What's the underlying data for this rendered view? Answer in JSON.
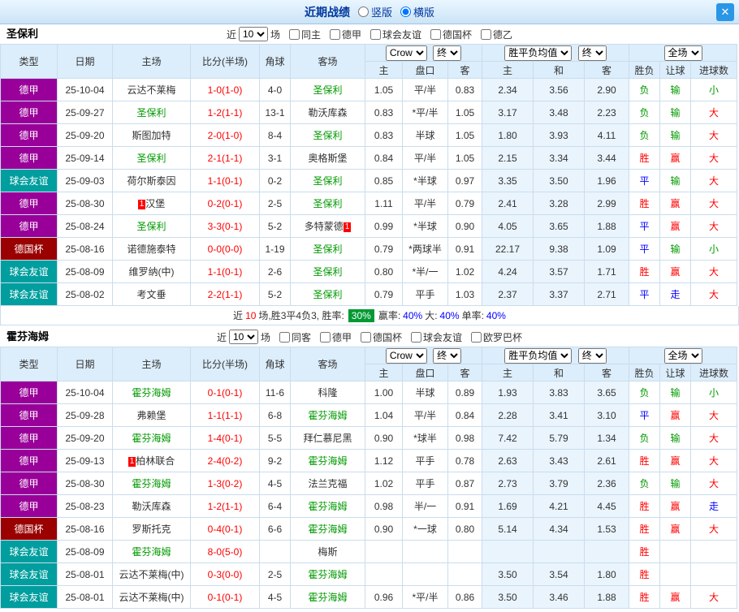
{
  "titlebar": {
    "title": "近期战绩",
    "vertical": "竖版",
    "horizontal": "横版",
    "close_icon": "✕"
  },
  "columns": {
    "type": "类型",
    "date": "日期",
    "home": "主场",
    "score": "比分(半场)",
    "corner": "角球",
    "away": "客场",
    "o_home": "主",
    "o_line": "盘口",
    "o_away": "客",
    "a_home": "主",
    "a_draw": "和",
    "a_away": "客",
    "r_wdl": "胜负",
    "r_handicap": "让球",
    "r_goals": "进球数"
  },
  "dropdowns": {
    "crow": "Crow",
    "final": "终",
    "avg": "胜平负均值",
    "full": "全场"
  },
  "badge_text": "1",
  "sections": [
    {
      "team": "圣保利",
      "filter": {
        "near": "近",
        "count": "10",
        "unit": "场",
        "checks": [
          "同主",
          "德甲",
          "球会友谊",
          "德国杯",
          "德乙"
        ]
      },
      "rows": [
        {
          "type": "德甲",
          "tc": "purple",
          "date": "25-10-04",
          "home": {
            "name": "云达不莱梅"
          },
          "score": "1-0(1-0)",
          "corner": "4-0",
          "away": {
            "name": "圣保利",
            "tracked": true
          },
          "odds": [
            "1.05",
            "平/半",
            "0.83"
          ],
          "avg": [
            "2.34",
            "3.56",
            "2.90"
          ],
          "res": [
            [
              "负",
              "g"
            ],
            [
              "输",
              "g"
            ],
            [
              "小",
              "g"
            ]
          ]
        },
        {
          "type": "德甲",
          "tc": "purple",
          "date": "25-09-27",
          "home": {
            "name": "圣保利",
            "tracked": true
          },
          "score": "1-2(1-1)",
          "corner": "13-1",
          "away": {
            "name": "勒沃库森"
          },
          "odds": [
            "0.83",
            "*平/半",
            "1.05"
          ],
          "avg": [
            "3.17",
            "3.48",
            "2.23"
          ],
          "res": [
            [
              "负",
              "g"
            ],
            [
              "输",
              "g"
            ],
            [
              "大",
              "r"
            ]
          ]
        },
        {
          "type": "德甲",
          "tc": "purple",
          "date": "25-09-20",
          "home": {
            "name": "斯图加特"
          },
          "score": "2-0(1-0)",
          "corner": "8-4",
          "away": {
            "name": "圣保利",
            "tracked": true
          },
          "odds": [
            "0.83",
            "半球",
            "1.05"
          ],
          "avg": [
            "1.80",
            "3.93",
            "4.11"
          ],
          "res": [
            [
              "负",
              "g"
            ],
            [
              "输",
              "g"
            ],
            [
              "大",
              "r"
            ]
          ]
        },
        {
          "type": "德甲",
          "tc": "purple",
          "date": "25-09-14",
          "home": {
            "name": "圣保利",
            "tracked": true
          },
          "score": "2-1(1-1)",
          "corner": "3-1",
          "away": {
            "name": "奥格斯堡"
          },
          "odds": [
            "0.84",
            "平/半",
            "1.05"
          ],
          "avg": [
            "2.15",
            "3.34",
            "3.44"
          ],
          "res": [
            [
              "胜",
              "r"
            ],
            [
              "赢",
              "r"
            ],
            [
              "大",
              "r"
            ]
          ]
        },
        {
          "type": "球会友谊",
          "tc": "teal",
          "date": "25-09-03",
          "home": {
            "name": "荷尔斯泰因"
          },
          "score": "1-1(0-1)",
          "corner": "0-2",
          "away": {
            "name": "圣保利",
            "tracked": true
          },
          "odds": [
            "0.85",
            "*半球",
            "0.97"
          ],
          "avg": [
            "3.35",
            "3.50",
            "1.96"
          ],
          "res": [
            [
              "平",
              "b"
            ],
            [
              "输",
              "g"
            ],
            [
              "大",
              "r"
            ]
          ]
        },
        {
          "type": "德甲",
          "tc": "purple",
          "date": "25-08-30",
          "home": {
            "name": "汉堡",
            "badge": "pre"
          },
          "score": "0-2(0-1)",
          "corner": "2-5",
          "away": {
            "name": "圣保利",
            "tracked": true
          },
          "odds": [
            "1.11",
            "平/半",
            "0.79"
          ],
          "avg": [
            "2.41",
            "3.28",
            "2.99"
          ],
          "res": [
            [
              "胜",
              "r"
            ],
            [
              "赢",
              "r"
            ],
            [
              "大",
              "r"
            ]
          ]
        },
        {
          "type": "德甲",
          "tc": "purple",
          "date": "25-08-24",
          "home": {
            "name": "圣保利",
            "tracked": true
          },
          "score": "3-3(0-1)",
          "corner": "5-2",
          "away": {
            "name": "多特蒙德",
            "badge": "post"
          },
          "odds": [
            "0.99",
            "*半球",
            "0.90"
          ],
          "avg": [
            "4.05",
            "3.65",
            "1.88"
          ],
          "res": [
            [
              "平",
              "b"
            ],
            [
              "赢",
              "r"
            ],
            [
              "大",
              "r"
            ]
          ]
        },
        {
          "type": "德国杯",
          "tc": "darkred",
          "date": "25-08-16",
          "home": {
            "name": "诺德施泰特"
          },
          "score": "0-0(0-0)",
          "corner": "1-19",
          "away": {
            "name": "圣保利",
            "tracked": true
          },
          "odds": [
            "0.79",
            "*两球半",
            "0.91"
          ],
          "avg": [
            "22.17",
            "9.38",
            "1.09"
          ],
          "res": [
            [
              "平",
              "b"
            ],
            [
              "输",
              "g"
            ],
            [
              "小",
              "g"
            ]
          ]
        },
        {
          "type": "球会友谊",
          "tc": "teal",
          "date": "25-08-09",
          "home": {
            "name": "维罗纳(中)"
          },
          "score": "1-1(0-1)",
          "corner": "2-6",
          "away": {
            "name": "圣保利",
            "tracked": true
          },
          "odds": [
            "0.80",
            "*半/一",
            "1.02"
          ],
          "avg": [
            "4.24",
            "3.57",
            "1.71"
          ],
          "res": [
            [
              "胜",
              "r"
            ],
            [
              "赢",
              "r"
            ],
            [
              "大",
              "r"
            ]
          ]
        },
        {
          "type": "球会友谊",
          "tc": "teal",
          "date": "25-08-02",
          "home": {
            "name": "考文垂"
          },
          "score": "2-2(1-1)",
          "corner": "5-2",
          "away": {
            "name": "圣保利",
            "tracked": true
          },
          "odds": [
            "0.79",
            "平手",
            "1.03"
          ],
          "avg": [
            "2.37",
            "3.37",
            "2.71"
          ],
          "res": [
            [
              "平",
              "b"
            ],
            [
              "走",
              "b"
            ],
            [
              "大",
              "r"
            ]
          ]
        }
      ],
      "summary": {
        "near": "近",
        "count": "10",
        "stats": "场,胜3平4负3, 胜率:",
        "win_rate": "30%",
        "labels": [
          "赢率:",
          "大:",
          "单率:"
        ],
        "values": [
          "40%",
          "40%",
          "40%"
        ]
      }
    },
    {
      "team": "霍芬海姆",
      "filter": {
        "near": "近",
        "count": "10",
        "unit": "场",
        "checks": [
          "同客",
          "德甲",
          "德国杯",
          "球会友谊",
          "欧罗巴杯"
        ]
      },
      "rows": [
        {
          "type": "德甲",
          "tc": "purple",
          "date": "25-10-04",
          "home": {
            "name": "霍芬海姆",
            "tracked": true
          },
          "score": "0-1(0-1)",
          "corner": "11-6",
          "away": {
            "name": "科隆"
          },
          "odds": [
            "1.00",
            "半球",
            "0.89"
          ],
          "avg": [
            "1.93",
            "3.83",
            "3.65"
          ],
          "res": [
            [
              "负",
              "g"
            ],
            [
              "输",
              "g"
            ],
            [
              "小",
              "g"
            ]
          ]
        },
        {
          "type": "德甲",
          "tc": "purple",
          "date": "25-09-28",
          "home": {
            "name": "弗赖堡"
          },
          "score": "1-1(1-1)",
          "corner": "6-8",
          "away": {
            "name": "霍芬海姆",
            "tracked": true
          },
          "odds": [
            "1.04",
            "平/半",
            "0.84"
          ],
          "avg": [
            "2.28",
            "3.41",
            "3.10"
          ],
          "res": [
            [
              "平",
              "b"
            ],
            [
              "赢",
              "r"
            ],
            [
              "大",
              "r"
            ]
          ]
        },
        {
          "type": "德甲",
          "tc": "purple",
          "date": "25-09-20",
          "home": {
            "name": "霍芬海姆",
            "tracked": true
          },
          "score": "1-4(0-1)",
          "corner": "5-5",
          "away": {
            "name": "拜仁慕尼黑"
          },
          "odds": [
            "0.90",
            "*球半",
            "0.98"
          ],
          "avg": [
            "7.42",
            "5.79",
            "1.34"
          ],
          "res": [
            [
              "负",
              "g"
            ],
            [
              "输",
              "g"
            ],
            [
              "大",
              "r"
            ]
          ]
        },
        {
          "type": "德甲",
          "tc": "purple",
          "date": "25-09-13",
          "home": {
            "name": "柏林联合",
            "badge": "pre"
          },
          "score": "2-4(0-2)",
          "corner": "9-2",
          "away": {
            "name": "霍芬海姆",
            "tracked": true
          },
          "odds": [
            "1.12",
            "平手",
            "0.78"
          ],
          "avg": [
            "2.63",
            "3.43",
            "2.61"
          ],
          "res": [
            [
              "胜",
              "r"
            ],
            [
              "赢",
              "r"
            ],
            [
              "大",
              "r"
            ]
          ]
        },
        {
          "type": "德甲",
          "tc": "purple",
          "date": "25-08-30",
          "home": {
            "name": "霍芬海姆",
            "tracked": true
          },
          "score": "1-3(0-2)",
          "corner": "4-5",
          "away": {
            "name": "法兰克福"
          },
          "odds": [
            "1.02",
            "平手",
            "0.87"
          ],
          "avg": [
            "2.73",
            "3.79",
            "2.36"
          ],
          "res": [
            [
              "负",
              "g"
            ],
            [
              "输",
              "g"
            ],
            [
              "大",
              "r"
            ]
          ]
        },
        {
          "type": "德甲",
          "tc": "purple",
          "date": "25-08-23",
          "home": {
            "name": "勒沃库森"
          },
          "score": "1-2(1-1)",
          "corner": "6-4",
          "away": {
            "name": "霍芬海姆",
            "tracked": true
          },
          "odds": [
            "0.98",
            "半/一",
            "0.91"
          ],
          "avg": [
            "1.69",
            "4.21",
            "4.45"
          ],
          "res": [
            [
              "胜",
              "r"
            ],
            [
              "赢",
              "r"
            ],
            [
              "走",
              "b"
            ]
          ]
        },
        {
          "type": "德国杯",
          "tc": "darkred",
          "date": "25-08-16",
          "home": {
            "name": "罗斯托克"
          },
          "score": "0-4(0-1)",
          "corner": "6-6",
          "away": {
            "name": "霍芬海姆",
            "tracked": true
          },
          "odds": [
            "0.90",
            "*一球",
            "0.80"
          ],
          "avg": [
            "5.14",
            "4.34",
            "1.53"
          ],
          "res": [
            [
              "胜",
              "r"
            ],
            [
              "赢",
              "r"
            ],
            [
              "大",
              "r"
            ]
          ]
        },
        {
          "type": "球会友谊",
          "tc": "teal",
          "date": "25-08-09",
          "home": {
            "name": "霍芬海姆",
            "tracked": true
          },
          "score": "8-0(5-0)",
          "corner": "",
          "away": {
            "name": "梅斯"
          },
          "odds": [
            "",
            "",
            ""
          ],
          "avg": [
            "",
            "",
            ""
          ],
          "res": [
            [
              "胜",
              "r"
            ],
            [
              "",
              ""
            ],
            [
              "",
              ""
            ]
          ]
        },
        {
          "type": "球会友谊",
          "tc": "teal",
          "date": "25-08-01",
          "home": {
            "name": "云达不莱梅(中)"
          },
          "score": "0-3(0-0)",
          "corner": "2-5",
          "away": {
            "name": "霍芬海姆",
            "tracked": true
          },
          "odds": [
            "",
            "",
            ""
          ],
          "avg": [
            "3.50",
            "3.54",
            "1.80"
          ],
          "res": [
            [
              "胜",
              "r"
            ],
            [
              "",
              ""
            ],
            [
              "",
              ""
            ]
          ]
        },
        {
          "type": "球会友谊",
          "tc": "teal",
          "date": "25-08-01",
          "home": {
            "name": "云达不莱梅(中)"
          },
          "score": "0-1(0-1)",
          "corner": "4-5",
          "away": {
            "name": "霍芬海姆",
            "tracked": true
          },
          "odds": [
            "0.96",
            "*平/半",
            "0.86"
          ],
          "avg": [
            "3.50",
            "3.46",
            "1.88"
          ],
          "res": [
            [
              "胜",
              "r"
            ],
            [
              "赢",
              "r"
            ],
            [
              "大",
              "r"
            ]
          ]
        }
      ]
    }
  ]
}
